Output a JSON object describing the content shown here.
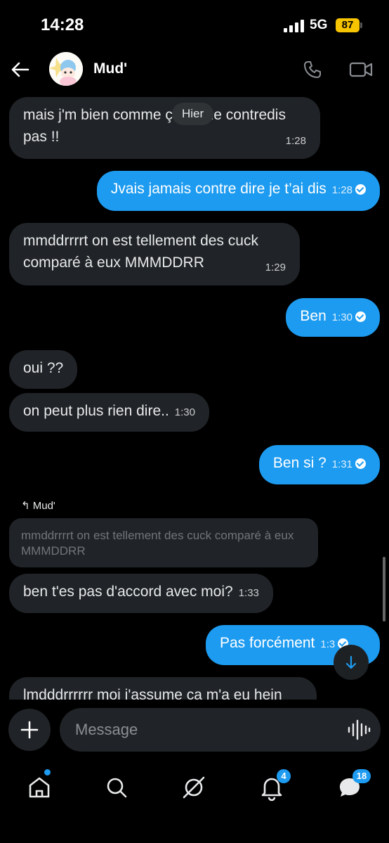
{
  "status": {
    "time": "14:28",
    "network": "5G",
    "battery": "87"
  },
  "header": {
    "contact_name": "Mud'"
  },
  "day_separator": "Hier",
  "messages": [
    {
      "dir": "in",
      "text": "mais j'm bien comme ça tu me contredis pas !!",
      "time": "1:28"
    },
    {
      "dir": "out",
      "text": "Jvais jamais contre dire je t’ai dis",
      "time": "1:28"
    },
    {
      "dir": "in",
      "text": "mmddrrrrt on est tellement des cuck comparé à eux MMMDDRR",
      "time": "1:29"
    },
    {
      "dir": "out",
      "text": "Ben",
      "time": "1:30"
    },
    {
      "dir": "in",
      "text": "oui ??",
      "time": ""
    },
    {
      "dir": "in",
      "text": "on peut plus rien dire..",
      "time": "1:30"
    },
    {
      "dir": "out",
      "text": "Ben si ?",
      "time": "1:31"
    },
    {
      "dir": "in",
      "text": "ben t'es pas d'accord avec moi?",
      "time": "1:33"
    },
    {
      "dir": "out",
      "text": "Pas forcément",
      "time": "1:3"
    },
    {
      "dir": "in",
      "text": "lmdddrrrrrr moi j'assume ça m'a eu hein",
      "time": ""
    }
  ],
  "reply": {
    "author": "Mud'",
    "quoted_text": "mmddrrrrt on est tellement des cuck comparé à eux MMMDDRR"
  },
  "composer": {
    "placeholder": "Message"
  },
  "nav": {
    "notifications_badge": "4",
    "messages_badge": "18"
  },
  "colors": {
    "accent": "#1d9bf0",
    "incoming_bubble": "#202327",
    "background": "#000000"
  }
}
